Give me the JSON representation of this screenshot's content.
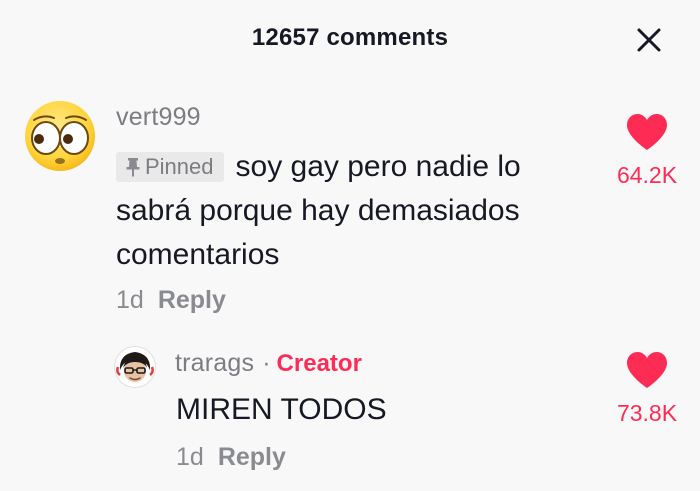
{
  "header": {
    "title": "12657 comments"
  },
  "comments": [
    {
      "username": "vert999",
      "pinned_label": "Pinned",
      "text": "soy gay pero nadie lo sabrá porque hay demasiados comentarios",
      "time": "1d",
      "reply_label": "Reply",
      "likes": "64.2K",
      "avatar": "eyes-emoji-avatar",
      "replies": [
        {
          "username": "trarags",
          "separator": "·",
          "badge": "Creator",
          "text": "MIREN TODOS",
          "time": "1d",
          "reply_label": "Reply",
          "likes": "73.8K",
          "avatar": "creator-avatar"
        }
      ]
    }
  ],
  "colors": {
    "accent": "#fe2c55",
    "text_primary": "#161823",
    "text_secondary": "#7c7c82",
    "background": "#f8f8f8",
    "pinned_bg": "#e9e9ea"
  },
  "icons": {
    "close": "close-icon",
    "like": "heart-icon",
    "pin": "pin-icon"
  }
}
